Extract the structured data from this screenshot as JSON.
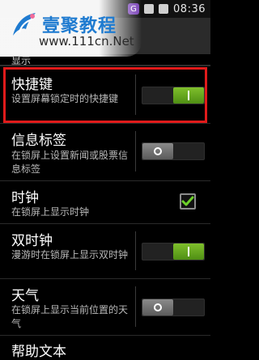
{
  "status_bar": {
    "time": "08:36",
    "icons": [
      "g-badge",
      "no-signal",
      "battery"
    ]
  },
  "watermark": {
    "title": "壹聚教程",
    "url": "www.111cn.Net",
    "brand_color": "#1f7bd0"
  },
  "section": {
    "label": "显示"
  },
  "settings": [
    {
      "title": "快捷键",
      "summary": "设置屏幕锁定时的快捷键",
      "control": "toggle",
      "state": "on"
    },
    {
      "title": "信息标签",
      "summary": "在锁屏上设置新闻或股票信息标签",
      "control": "toggle",
      "state": "off"
    },
    {
      "title": "时钟",
      "summary": "在锁屏上显示时钟",
      "control": "checkbox",
      "state": "checked"
    },
    {
      "title": "双时钟",
      "summary": "漫游时在锁屏上显示双时钟",
      "control": "toggle",
      "state": "on"
    },
    {
      "title": "天气",
      "summary": "在锁屏上显示当前位置的天气",
      "control": "toggle",
      "state": "off"
    },
    {
      "title": "帮助文本",
      "summary": "",
      "control": "none",
      "state": ""
    }
  ],
  "colors": {
    "toggle_on": "#6aa81f",
    "toggle_off": "#6b6b6b",
    "highlight": "#e01b1b",
    "checkbox_check": "#6ccf2a"
  }
}
